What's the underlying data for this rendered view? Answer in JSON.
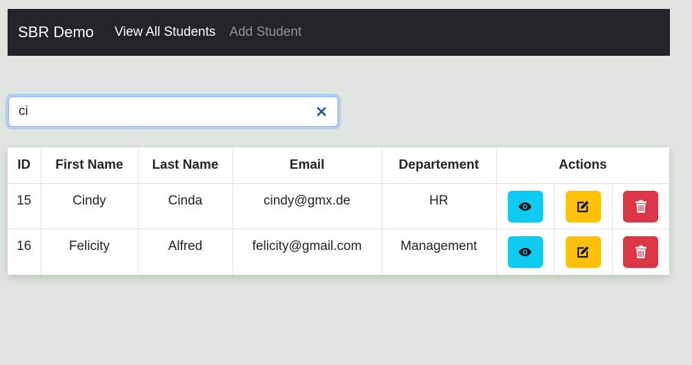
{
  "navbar": {
    "brand": "SBR Demo",
    "links": [
      {
        "label": "View All Students",
        "active": true
      },
      {
        "label": "Add Student",
        "active": false
      }
    ]
  },
  "search": {
    "value": "ci",
    "clear_icon": "close-icon"
  },
  "table": {
    "headers": [
      "ID",
      "First Name",
      "Last Name",
      "Email",
      "Departement",
      "Actions"
    ],
    "rows": [
      {
        "id": "15",
        "first_name": "Cindy",
        "last_name": "Cinda",
        "email": "cindy@gmx.de",
        "department": "HR"
      },
      {
        "id": "16",
        "first_name": "Felicity",
        "last_name": "Alfred",
        "email": "felicity@gmail.com",
        "department": "Management"
      }
    ],
    "actions": [
      {
        "icon": "eye-icon",
        "color": "#0dcaf0"
      },
      {
        "icon": "edit-icon",
        "color": "#ffc107"
      },
      {
        "icon": "trash-icon",
        "color": "#dc3545"
      }
    ]
  },
  "colors": {
    "navbar_bg": "#212529",
    "page_bg": "#e0e6df",
    "clear_icon": "#2b5694"
  }
}
